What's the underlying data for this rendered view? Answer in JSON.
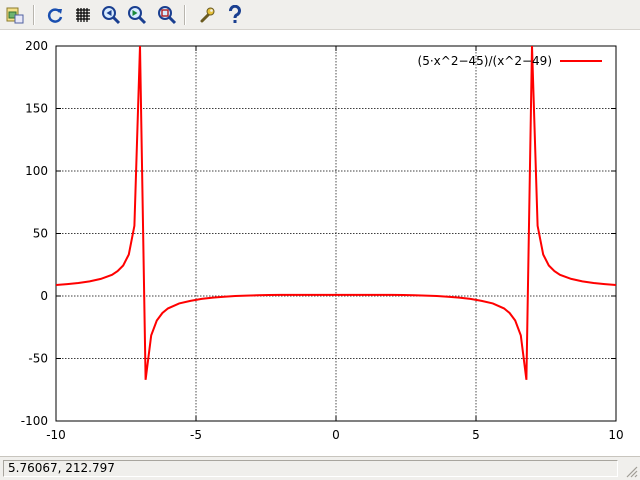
{
  "toolbar": {
    "buttons": [
      {
        "id": "export",
        "icon": "export-image-icon"
      },
      {
        "id": "replot",
        "icon": "refresh-icon"
      },
      {
        "id": "grid",
        "icon": "grid-icon"
      },
      {
        "id": "previous-zoom",
        "icon": "zoom-back-icon"
      },
      {
        "id": "next-zoom",
        "icon": "zoom-forward-icon"
      },
      {
        "id": "autoscale",
        "icon": "zoom-fit-icon"
      },
      {
        "id": "settings",
        "icon": "wrench-icon"
      },
      {
        "id": "help",
        "icon": "help-icon"
      }
    ]
  },
  "status": {
    "coordinates": "5.76067,  212.797"
  },
  "colors": {
    "curve": "#ff0000",
    "grid": "#000000",
    "toolbar_bg": "#f0efec"
  },
  "chart_data": {
    "type": "line",
    "function": "(5·x^2−45)/(x^2−49)",
    "xlim": [
      -10,
      10
    ],
    "ylim": [
      -100,
      200
    ],
    "xticks": [
      "-10",
      "-5",
      "0",
      "5",
      "10"
    ],
    "yticks": [
      "-100",
      "-50",
      "0",
      "50",
      "100",
      "150",
      "200"
    ],
    "grid": true,
    "legend_position": "top-right",
    "series": [
      {
        "name": "(5·x^2−45)/(x^2−49)",
        "x": [
          -10,
          -9.6,
          -9.2,
          -8.8,
          -8.4,
          -8.0,
          -7.8,
          -7.6,
          -7.4,
          -7.2,
          -7.0,
          -6.8,
          -6.6,
          -6.4,
          -6.2,
          -6.0,
          -5.6,
          -5.2,
          -4.8,
          -4.4,
          -4.0,
          -3.6,
          -3.2,
          -2.8,
          -2.4,
          -2.0,
          -1.6,
          -1.2,
          -0.8,
          -0.4,
          0,
          0.4,
          0.8,
          1.2,
          1.6,
          2.0,
          2.4,
          2.8,
          3.2,
          3.6,
          4.0,
          4.4,
          4.8,
          5.2,
          5.6,
          6.0,
          6.2,
          6.4,
          6.6,
          6.8,
          7.0,
          7.2,
          7.4,
          7.6,
          7.8,
          8.0,
          8.4,
          8.8,
          9.2,
          9.6,
          10
        ],
        "y": [
          8.8,
          9.5,
          10.4,
          11.7,
          13.7,
          17.0,
          19.9,
          24.4,
          33.2,
          56.2,
          200,
          -67.0,
          -31.5,
          -19.6,
          -13.6,
          -9.9,
          -5.9,
          -3.9,
          -2.3,
          -1.3,
          -0.6,
          0.0,
          0.3,
          0.6,
          0.8,
          0.9,
          0.9,
          0.9,
          0.9,
          0.9,
          0.9,
          0.9,
          0.9,
          0.9,
          0.9,
          0.9,
          0.8,
          0.6,
          0.3,
          0.0,
          -0.6,
          -1.3,
          -2.3,
          -3.9,
          -5.9,
          -9.9,
          -13.6,
          -19.6,
          -31.5,
          -67.0,
          200,
          56.2,
          33.2,
          24.4,
          19.9,
          17.0,
          13.7,
          11.7,
          10.4,
          9.5,
          8.8
        ]
      }
    ]
  }
}
